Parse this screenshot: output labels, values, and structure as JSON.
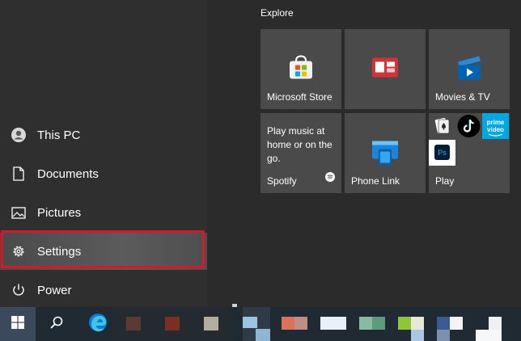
{
  "nav": {
    "items": [
      {
        "label": "This PC",
        "icon": "user-icon"
      },
      {
        "label": "Documents",
        "icon": "document-icon"
      },
      {
        "label": "Pictures",
        "icon": "picture-icon"
      },
      {
        "label": "Settings",
        "icon": "gear-icon"
      },
      {
        "label": "Power",
        "icon": "power-icon"
      }
    ],
    "selected": "Settings"
  },
  "group": {
    "title": "Explore"
  },
  "tiles": {
    "store": {
      "label": "Microsoft Store"
    },
    "news": {
      "label": ""
    },
    "movies": {
      "label": "Movies & TV"
    },
    "spotify": {
      "label": "Spotify",
      "description": "Play music at home or on the go."
    },
    "phone": {
      "label": "Phone Link"
    },
    "play": {
      "label": "Play"
    }
  },
  "colors": {
    "accent_highlight": "#d5192b",
    "tile_bg": "#4a4a4a",
    "taskbar_bg": "#1f2a33"
  }
}
